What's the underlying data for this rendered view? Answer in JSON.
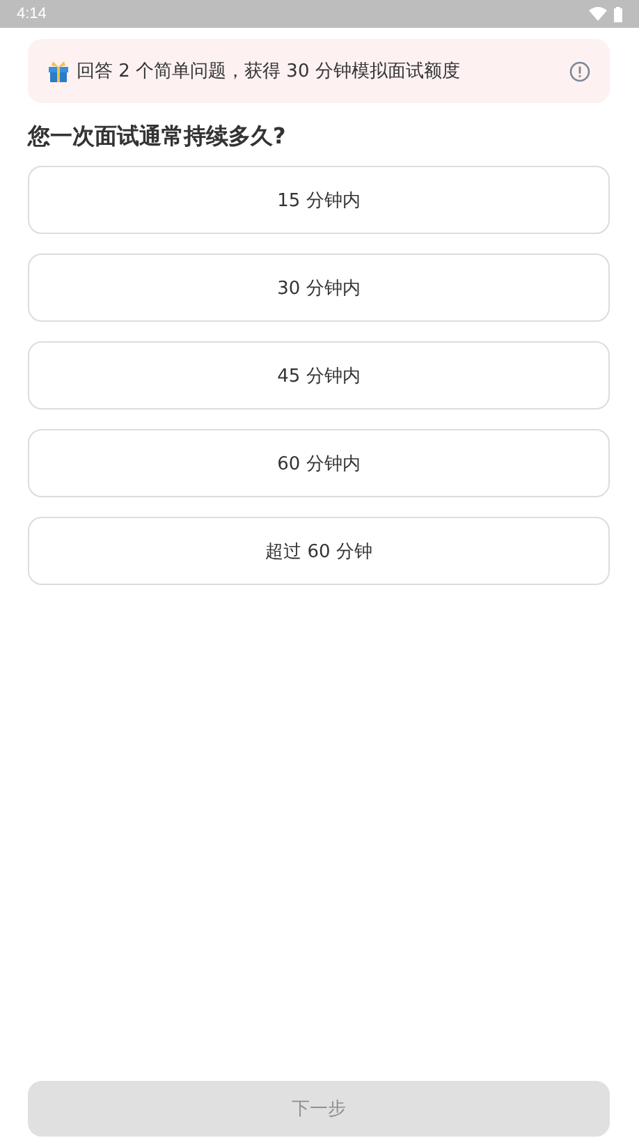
{
  "status_bar": {
    "time": "4:14"
  },
  "banner": {
    "text": "回答 2 个简单问题，获得 30 分钟模拟面试额度"
  },
  "question": "您一次面试通常持续多久?",
  "options": [
    {
      "label": "15 分钟内",
      "selected": false
    },
    {
      "label": "30 分钟内",
      "selected": false
    },
    {
      "label": "45 分钟内",
      "selected": false
    },
    {
      "label": "60 分钟内",
      "selected": false
    },
    {
      "label": "超过 60 分钟",
      "selected": false
    }
  ],
  "next_button": {
    "label": "下一步",
    "disabled": true
  }
}
